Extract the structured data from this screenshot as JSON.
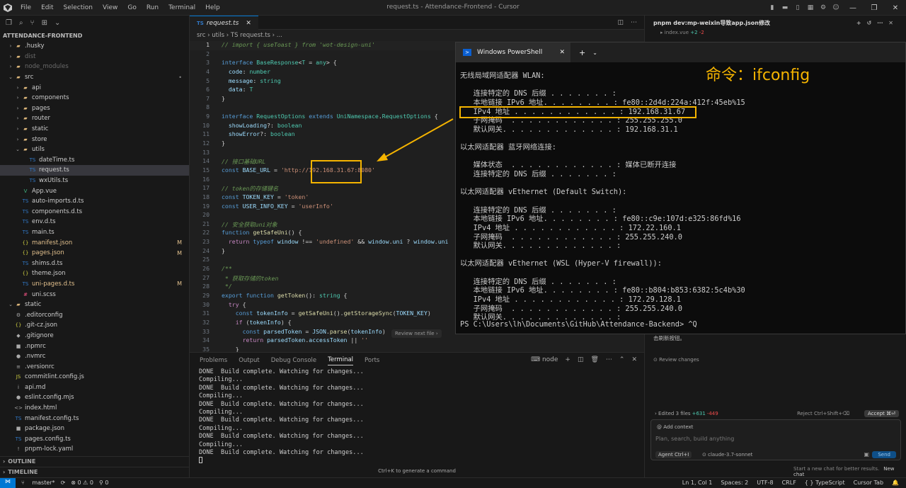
{
  "window": {
    "title": "request.ts - Attendance-Frontend - Cursor",
    "menu": [
      "File",
      "Edit",
      "Selection",
      "View",
      "Go",
      "Run",
      "Terminal",
      "Help"
    ]
  },
  "explorer": {
    "header": "ATTENDANCE-FRONTEND",
    "items": [
      {
        "name": ".husky",
        "kind": "folder",
        "depth": 1,
        "icon": "folder",
        "cls": ""
      },
      {
        "name": "dist",
        "kind": "folder",
        "depth": 1,
        "icon": "folder",
        "cls": "dim"
      },
      {
        "name": "node_modules",
        "kind": "folder",
        "depth": 1,
        "icon": "folder",
        "cls": "dim"
      },
      {
        "name": "src",
        "kind": "folder-open",
        "depth": 1,
        "icon": "folder",
        "cls": "",
        "badge": "•"
      },
      {
        "name": "api",
        "kind": "folder",
        "depth": 2,
        "icon": "folder",
        "cls": ""
      },
      {
        "name": "components",
        "kind": "folder",
        "depth": 2,
        "icon": "folder",
        "cls": ""
      },
      {
        "name": "pages",
        "kind": "folder",
        "depth": 2,
        "icon": "folder",
        "cls": ""
      },
      {
        "name": "router",
        "kind": "folder",
        "depth": 2,
        "icon": "folder",
        "cls": ""
      },
      {
        "name": "static",
        "kind": "folder",
        "depth": 2,
        "icon": "folder",
        "cls": ""
      },
      {
        "name": "store",
        "kind": "folder",
        "depth": 2,
        "icon": "folder",
        "cls": ""
      },
      {
        "name": "utils",
        "kind": "folder-open",
        "depth": 2,
        "icon": "folder",
        "cls": ""
      },
      {
        "name": "dateTime.ts",
        "kind": "file",
        "depth": 3,
        "icon": "TS",
        "cls": ""
      },
      {
        "name": "request.ts",
        "kind": "file",
        "depth": 3,
        "icon": "TS",
        "cls": "",
        "selected": true
      },
      {
        "name": "wxUtils.ts",
        "kind": "file",
        "depth": 3,
        "icon": "TS",
        "cls": ""
      },
      {
        "name": "App.vue",
        "kind": "file",
        "depth": 2,
        "icon": "V",
        "cls": ""
      },
      {
        "name": "auto-imports.d.ts",
        "kind": "file",
        "depth": 2,
        "icon": "TS",
        "cls": ""
      },
      {
        "name": "components.d.ts",
        "kind": "file",
        "depth": 2,
        "icon": "TS",
        "cls": ""
      },
      {
        "name": "env.d.ts",
        "kind": "file",
        "depth": 2,
        "icon": "TS",
        "cls": ""
      },
      {
        "name": "main.ts",
        "kind": "file",
        "depth": 2,
        "icon": "TS",
        "cls": ""
      },
      {
        "name": "manifest.json",
        "kind": "file",
        "depth": 2,
        "icon": "{}",
        "cls": "mod",
        "badge": "M"
      },
      {
        "name": "pages.json",
        "kind": "file",
        "depth": 2,
        "icon": "{}",
        "cls": "mod",
        "badge": "M"
      },
      {
        "name": "shims.d.ts",
        "kind": "file",
        "depth": 2,
        "icon": "TS",
        "cls": ""
      },
      {
        "name": "theme.json",
        "kind": "file",
        "depth": 2,
        "icon": "{}",
        "cls": ""
      },
      {
        "name": "uni-pages.d.ts",
        "kind": "file",
        "depth": 2,
        "icon": "TS",
        "cls": "mod",
        "badge": "M"
      },
      {
        "name": "uni.scss",
        "kind": "file",
        "depth": 2,
        "icon": "#",
        "cls": ""
      },
      {
        "name": "static",
        "kind": "folder-open",
        "depth": 1,
        "icon": "folder",
        "cls": ""
      },
      {
        "name": ".editorconfig",
        "kind": "file",
        "depth": 1,
        "icon": "⚙",
        "cls": ""
      },
      {
        "name": ".git-cz.json",
        "kind": "file",
        "depth": 1,
        "icon": "{}",
        "cls": ""
      },
      {
        "name": ".gitignore",
        "kind": "file",
        "depth": 1,
        "icon": "◆",
        "cls": ""
      },
      {
        "name": ".npmrc",
        "kind": "file",
        "depth": 1,
        "icon": "■",
        "cls": ""
      },
      {
        "name": ".nvmrc",
        "kind": "file",
        "depth": 1,
        "icon": "●",
        "cls": ""
      },
      {
        "name": ".versionrc",
        "kind": "file",
        "depth": 1,
        "icon": "≡",
        "cls": ""
      },
      {
        "name": "commitlint.config.js",
        "kind": "file",
        "depth": 1,
        "icon": "JS",
        "cls": ""
      },
      {
        "name": "api.md",
        "kind": "file",
        "depth": 1,
        "icon": "i",
        "cls": ""
      },
      {
        "name": "eslint.config.mjs",
        "kind": "file",
        "depth": 1,
        "icon": "●",
        "cls": ""
      },
      {
        "name": "index.html",
        "kind": "file",
        "depth": 1,
        "icon": "<>",
        "cls": ""
      },
      {
        "name": "manifest.config.ts",
        "kind": "file",
        "depth": 1,
        "icon": "TS",
        "cls": ""
      },
      {
        "name": "package.json",
        "kind": "file",
        "depth": 1,
        "icon": "■",
        "cls": ""
      },
      {
        "name": "pages.config.ts",
        "kind": "file",
        "depth": 1,
        "icon": "TS",
        "cls": ""
      },
      {
        "name": "pnpm-lock.yaml",
        "kind": "file",
        "depth": 1,
        "icon": "!",
        "cls": ""
      }
    ],
    "outline": "OUTLINE",
    "timeline": "TIMELINE"
  },
  "editor": {
    "tab": "request.ts",
    "breadcrumb": "src  ›  utils  ›  TS  request.ts  ›  ...",
    "lines": [
      [
        [
          "c",
          "// import { useToast } from 'wot-design-uni'"
        ]
      ],
      [],
      [
        [
          "k",
          "interface "
        ],
        [
          "t",
          "BaseResponse"
        ],
        [
          "o",
          "<"
        ],
        [
          "t",
          "T"
        ],
        [
          "o",
          " = "
        ],
        [
          "t",
          "any"
        ],
        [
          "o",
          "> {"
        ]
      ],
      [
        [
          "o",
          "  "
        ],
        [
          "p",
          "code"
        ],
        [
          "o",
          ": "
        ],
        [
          "t",
          "number"
        ]
      ],
      [
        [
          "o",
          "  "
        ],
        [
          "p",
          "message"
        ],
        [
          "o",
          ": "
        ],
        [
          "t",
          "string"
        ]
      ],
      [
        [
          "o",
          "  "
        ],
        [
          "p",
          "data"
        ],
        [
          "o",
          ": "
        ],
        [
          "t",
          "T"
        ]
      ],
      [
        [
          "o",
          "}"
        ]
      ],
      [],
      [
        [
          "k",
          "interface "
        ],
        [
          "t",
          "RequestOptions "
        ],
        [
          "k",
          "extends "
        ],
        [
          "t",
          "UniNamespace"
        ],
        [
          "o",
          "."
        ],
        [
          "t",
          "RequestOptions"
        ],
        [
          "o",
          " {"
        ]
      ],
      [
        [
          "o",
          "  "
        ],
        [
          "p",
          "showLoading"
        ],
        [
          "o",
          "?: "
        ],
        [
          "t",
          "boolean"
        ]
      ],
      [
        [
          "o",
          "  "
        ],
        [
          "p",
          "showError"
        ],
        [
          "o",
          "?: "
        ],
        [
          "t",
          "boolean"
        ]
      ],
      [
        [
          "o",
          "}"
        ]
      ],
      [],
      [
        [
          "c",
          "// 接口基础URL"
        ]
      ],
      [
        [
          "k",
          "const "
        ],
        [
          "p",
          "BASE_URL"
        ],
        [
          "o",
          " = "
        ],
        [
          "s",
          "'http://192.168.31.67:8080'"
        ]
      ],
      [],
      [
        [
          "c",
          "// token的存储键名"
        ]
      ],
      [
        [
          "k",
          "const "
        ],
        [
          "p",
          "TOKEN_KEY"
        ],
        [
          "o",
          " = "
        ],
        [
          "s",
          "'token'"
        ]
      ],
      [
        [
          "k",
          "const "
        ],
        [
          "p",
          "USER_INFO_KEY"
        ],
        [
          "o",
          " = "
        ],
        [
          "s",
          "'userInfo'"
        ]
      ],
      [],
      [
        [
          "c",
          "// 安全获取uni对象"
        ]
      ],
      [
        [
          "k",
          "function "
        ],
        [
          "f",
          "getSafeUni"
        ],
        [
          "o",
          "() {"
        ]
      ],
      [
        [
          "o",
          "  "
        ],
        [
          "cf",
          "return "
        ],
        [
          "k",
          "typeof "
        ],
        [
          "p",
          "window"
        ],
        [
          "o",
          " !== "
        ],
        [
          "s",
          "'undefined'"
        ],
        [
          "o",
          " && "
        ],
        [
          "p",
          "window"
        ],
        [
          "o",
          "."
        ],
        [
          "p",
          "uni"
        ],
        [
          "o",
          " ? "
        ],
        [
          "p",
          "window"
        ],
        [
          "o",
          "."
        ],
        [
          "p",
          "uni"
        ]
      ],
      [
        [
          "o",
          "}"
        ]
      ],
      [],
      [
        [
          "c",
          "/**"
        ]
      ],
      [
        [
          "c",
          " * 获取存储的token"
        ]
      ],
      [
        [
          "c",
          " */"
        ]
      ],
      [
        [
          "k",
          "export function "
        ],
        [
          "f",
          "getToken"
        ],
        [
          "o",
          "(): "
        ],
        [
          "t",
          "string"
        ],
        [
          "o",
          " {"
        ]
      ],
      [
        [
          "o",
          "  "
        ],
        [
          "cf",
          "try"
        ],
        [
          "o",
          " {"
        ]
      ],
      [
        [
          "o",
          "    "
        ],
        [
          "k",
          "const "
        ],
        [
          "p",
          "tokenInfo"
        ],
        [
          "o",
          " = "
        ],
        [
          "f",
          "getSafeUni"
        ],
        [
          "o",
          "()."
        ],
        [
          "f",
          "getStorageSync"
        ],
        [
          "o",
          "("
        ],
        [
          "p",
          "TOKEN_KEY"
        ],
        [
          "o",
          ")"
        ]
      ],
      [
        [
          "o",
          "    "
        ],
        [
          "cf",
          "if"
        ],
        [
          "o",
          " ("
        ],
        [
          "p",
          "tokenInfo"
        ],
        [
          "o",
          ") {"
        ]
      ],
      [
        [
          "o",
          "      "
        ],
        [
          "k",
          "const "
        ],
        [
          "p",
          "parsedToken"
        ],
        [
          "o",
          " = "
        ],
        [
          "p",
          "JSON"
        ],
        [
          "o",
          "."
        ],
        [
          "f",
          "parse"
        ],
        [
          "o",
          "("
        ],
        [
          "p",
          "tokenInfo"
        ],
        [
          "o",
          ")"
        ]
      ],
      [
        [
          "o",
          "      "
        ],
        [
          "cf",
          "return "
        ],
        [
          "p",
          "parsedToken"
        ],
        [
          "o",
          "."
        ],
        [
          "p",
          "accessToken"
        ],
        [
          "o",
          " || "
        ],
        [
          "s",
          "''"
        ]
      ],
      [
        [
          "o",
          "    }"
        ]
      ]
    ],
    "review_next": "Review next file  ›"
  },
  "panel": {
    "tabs": [
      "Problems",
      "Output",
      "Debug Console",
      "Terminal",
      "Ports"
    ],
    "active": "Terminal",
    "tool_node": "node",
    "lines": [
      "DONE  Build complete. Watching for changes...",
      "Compiling...",
      "DONE  Build complete. Watching for changes...",
      "Compiling...",
      "DONE  Build complete. Watching for changes...",
      "Compiling...",
      "DONE  Build complete. Watching for changes...",
      "Compiling...",
      "DONE  Build complete. Watching for changes...",
      "Compiling...",
      "DONE  Build complete. Watching for changes..."
    ],
    "ctrlk": "Ctrl+K to generate a command"
  },
  "powershell": {
    "tab_title": "Windows PowerShell",
    "lines": [
      "无线局域网适配器 WLAN:",
      "",
      "   连接特定的 DNS 后缀 . . . . . . . :",
      "   本地链接 IPv6 地址. . . . . . . . : fe80::2d4d:224a:412f:45eb%15",
      "   IPv4 地址 . . . . . . . . . . . . : 192.168.31.67",
      "   子网掩码  . . . . . . . . . . . . : 255.255.255.0",
      "   默认网关. . . . . . . . . . . . . : 192.168.31.1",
      "",
      "以太网适配器 蓝牙网络连接:",
      "",
      "   媒体状态  . . . . . . . . . . . . : 媒体已断开连接",
      "   连接特定的 DNS 后缀 . . . . . . . :",
      "",
      "以太网适配器 vEthernet (Default Switch):",
      "",
      "   连接特定的 DNS 后缀 . . . . . . . :",
      "   本地链接 IPv6 地址. . . . . . . . : fe80::c9e:107d:e325:86fd%16",
      "   IPv4 地址 . . . . . . . . . . . . : 172.22.160.1",
      "   子网掩码  . . . . . . . . . . . . : 255.255.240.0",
      "   默认网关. . . . . . . . . . . . . :",
      "",
      "以太网适配器 vEthernet (WSL (Hyper-V firewall)):",
      "",
      "   连接特定的 DNS 后缀 . . . . . . . :",
      "   本地链接 IPv6 地址. . . . . . . . : fe80::b804:b853:6382:5c4b%30",
      "   IPv4 地址 . . . . . . . . . . . . : 172.29.128.1",
      "   子网掩码  . . . . . . . . . . . . : 255.255.240.0",
      "   默认网关. . . . . . . . . . . . . :",
      "PS C:\\Users\\lh\\Documents\\GitHub\\Attendance-Backend> ^Q"
    ]
  },
  "annotation": {
    "command": "命令：ifconfig",
    "color": "#f5b400"
  },
  "chat": {
    "title": "pnpm dev:mp-weixin导致app.json修改",
    "file": "index.vue",
    "file_add": "+2",
    "file_del": "-2",
    "desc_tail": "击刷新按钮。",
    "review": "Review changes",
    "edited": "Edited 3 files",
    "edited_add": "+631",
    "edited_del": "-449",
    "reject": "Reject Ctrl+Shift+⌫",
    "accept": "Accept ⌘⏎",
    "add_context": "Add context",
    "placeholder": "Plan, search, build anything",
    "agent": "Agent Ctrl+I",
    "model": "claude-3.7-sonnet",
    "send": "Send",
    "newchat": "Start a new chat for better results.",
    "newchat_btn": "New chat"
  },
  "status": {
    "branch": "master*",
    "problems": "⊗ 0 ⚠ 0",
    "ports": "⚲ 0",
    "pos": "Ln 1, Col 1",
    "spaces": "Spaces: 2",
    "enc": "UTF-8",
    "eol": "CRLF",
    "lang": "{ } TypeScript",
    "tab": "Cursor Tab"
  }
}
